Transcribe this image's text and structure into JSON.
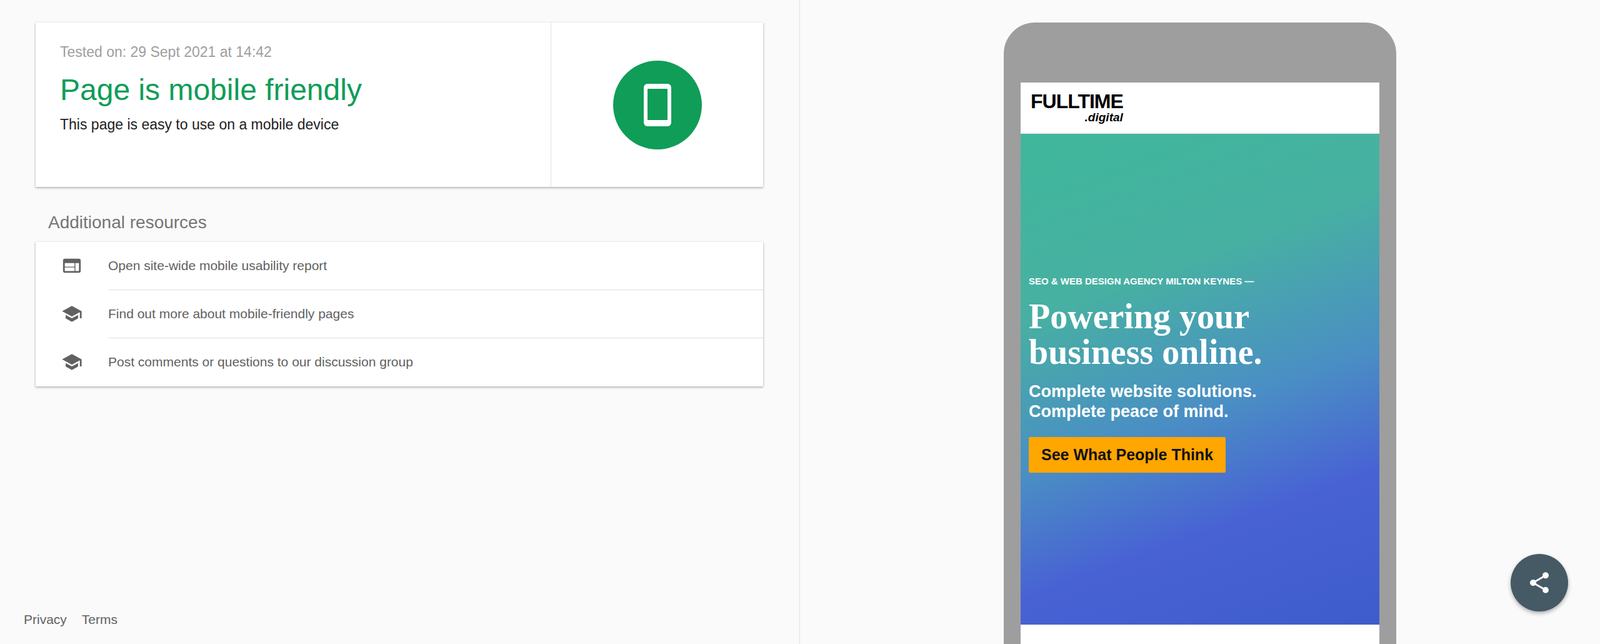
{
  "result": {
    "tested_on": "Tested on: 29 Sept 2021 at 14:42",
    "title": "Page is mobile friendly",
    "subtitle": "This page is easy to use on a mobile device"
  },
  "resources": {
    "heading": "Additional resources",
    "items": [
      {
        "label": "Open site-wide mobile usability report",
        "kind": "report"
      },
      {
        "label": "Find out more about mobile-friendly pages",
        "kind": "learn"
      },
      {
        "label": "Post comments or questions to our discussion group",
        "kind": "learn"
      }
    ]
  },
  "footer": [
    "Privacy",
    "Terms"
  ],
  "preview": {
    "logo": {
      "main": "FULLTIME",
      "sub": ".digital"
    },
    "eyebrow": "SEO & WEB DESIGN AGENCY MILTON KEYNES —",
    "headline": [
      "Powering your",
      "business online."
    ],
    "tagline": [
      "Complete website solutions.",
      "Complete peace of mind."
    ],
    "button": "See What People Think"
  }
}
